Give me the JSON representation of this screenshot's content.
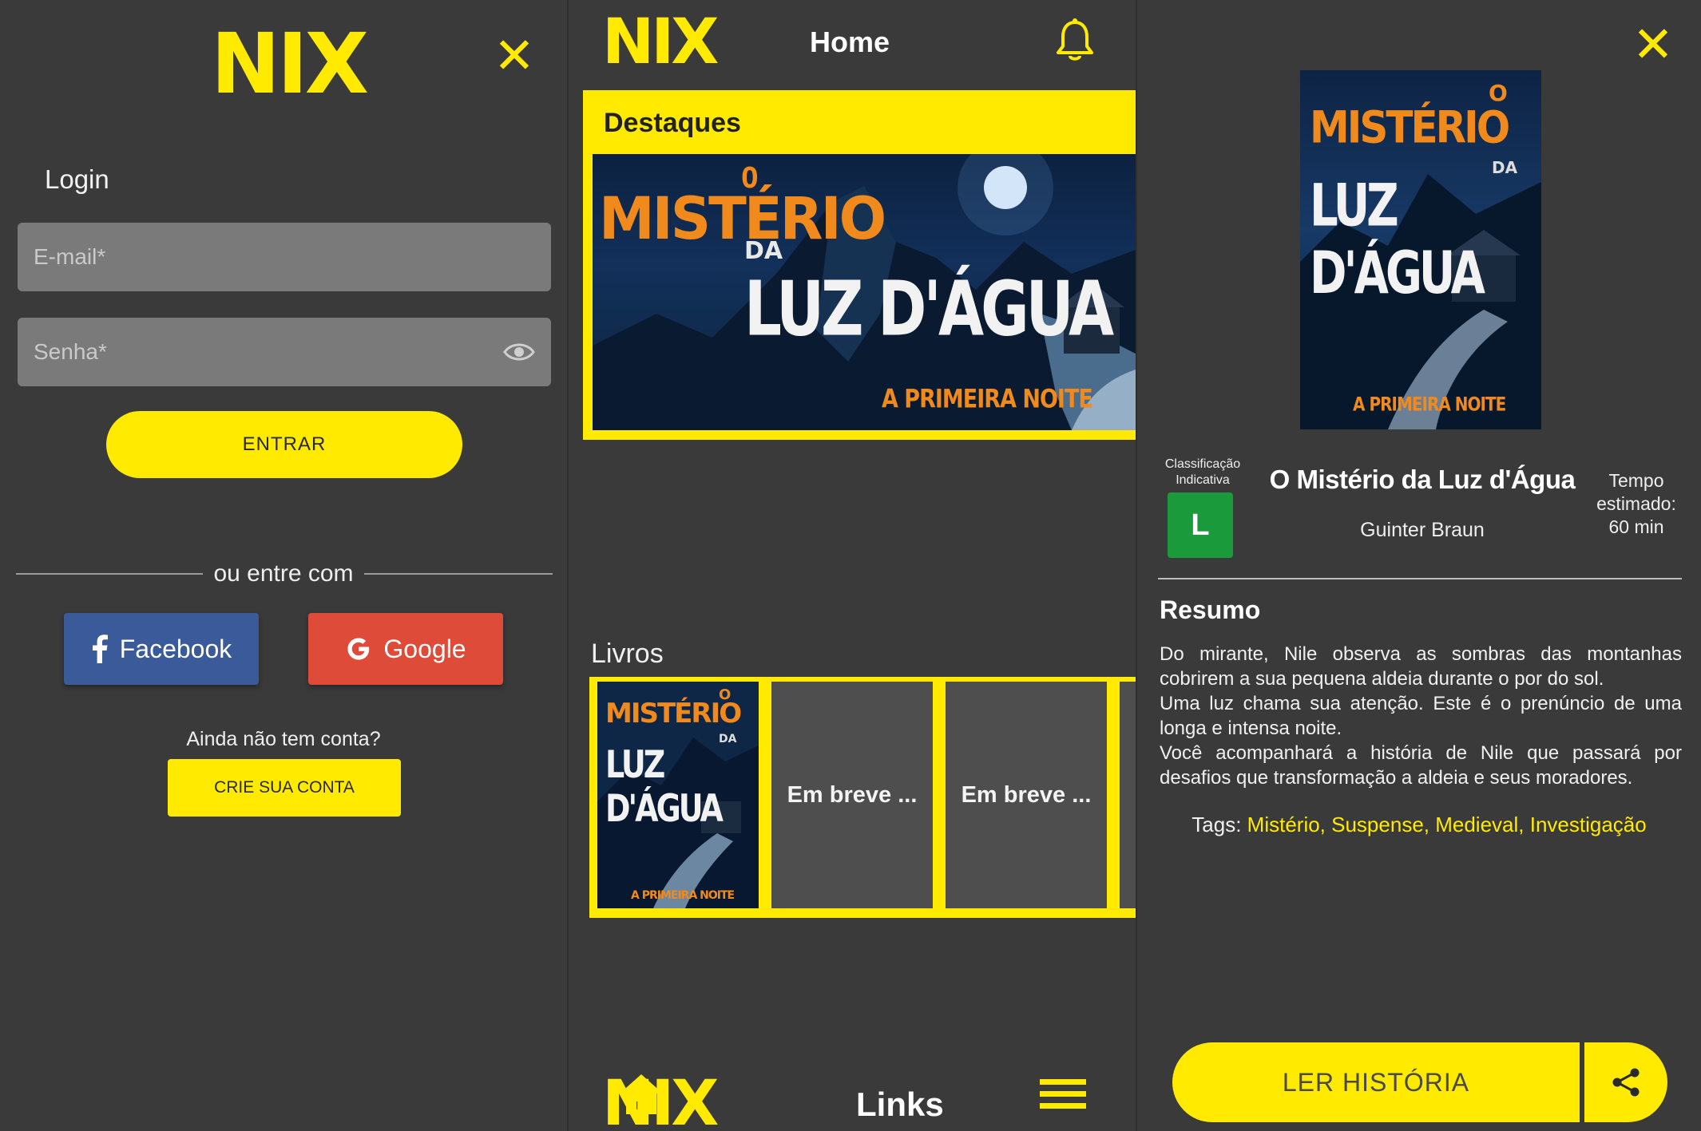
{
  "brand": {
    "logo_text": "NIX",
    "accent_color": "#ffea00",
    "background_color": "#3a3a3a"
  },
  "login": {
    "title": "Login",
    "email_placeholder": "E-mail*",
    "password_placeholder": "Senha*",
    "submit_label": "ENTRAR",
    "divider_text": "ou entre com",
    "facebook_label": "Facebook",
    "google_label": "Google",
    "no_account_text": "Ainda não tem conta?",
    "create_account_label": "CRIE SUA CONTA",
    "facebook_color": "#3b5a9a",
    "google_color": "#de4b39"
  },
  "home": {
    "title": "Home",
    "featured_title": "Destaques",
    "books_title": "Livros",
    "coming_soon": [
      "Em breve ...",
      "Em breve ..."
    ],
    "nav_links_label": "Links",
    "icons": [
      "bell-icon",
      "home-icon",
      "menu-icon"
    ]
  },
  "cover": {
    "line_o": "O",
    "line_misterio": "MISTÉRIO",
    "line_da": "DA",
    "line_luz": "LUZ D'ÁGUA",
    "line_subtitle": "A PRIMEIRA NOITE"
  },
  "detail": {
    "rating_label_1": "Classificação",
    "rating_label_2": "Indicativa",
    "rating_value": "L",
    "rating_color": "#1a9a3a",
    "title": "O Mistério da Luz d'Água",
    "author": "Guinter Braun",
    "time_label_1": "Tempo",
    "time_label_2": "estimado:",
    "time_value": "60 min",
    "summary_title": "Resumo",
    "summary_1": "Do mirante, Nile observa as sombras das montanhas cobrirem a sua pequena aldeia durante o por do sol.",
    "summary_2": "Uma luz chama sua atenção. Este é o prenúncio de uma longa e intensa noite.",
    "summary_3": "Você acompanhará a história de Nile que passará por desafios que transformação a aldeia e seus moradores.",
    "tags_label": "Tags:",
    "tags_value": "Mistério, Suspense, Medieval, Investigação",
    "read_label": "LER HISTÓRIA"
  }
}
